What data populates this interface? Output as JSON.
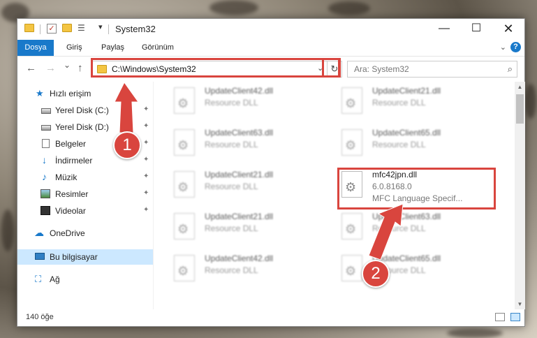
{
  "window": {
    "title": "System32",
    "minimize_glyph": "—",
    "maximize_glyph": "☐",
    "close_glyph": "✕",
    "qa_dropdown_glyph": "▾"
  },
  "ribbon": {
    "tabs": [
      "Dosya",
      "Giriş",
      "Paylaş",
      "Görünüm"
    ],
    "expand_glyph": "⌄",
    "help_glyph": "?"
  },
  "navigation": {
    "back_glyph": "←",
    "forward_glyph": "→",
    "recent_glyph": "⌄",
    "up_glyph": "↑",
    "address": "C:\\Windows\\System32",
    "address_dropdown_glyph": "⌄",
    "refresh_glyph": "↻",
    "search_placeholder": "Ara: System32",
    "search_glyph": "⌕"
  },
  "sidebar": {
    "items": [
      {
        "label": "Hızlı erişim",
        "icon": "star-icon",
        "glyph": "★"
      },
      {
        "label": "Yerel Disk (C:)",
        "icon": "disk-icon",
        "glyph": ""
      },
      {
        "label": "Yerel Disk (D:)",
        "icon": "disk-icon",
        "glyph": ""
      },
      {
        "label": "Belgeler",
        "icon": "documents-icon",
        "glyph": ""
      },
      {
        "label": "İndirmeler",
        "icon": "download-icon",
        "glyph": "↓"
      },
      {
        "label": "Müzik",
        "icon": "music-icon",
        "glyph": "♪"
      },
      {
        "label": "Resimler",
        "icon": "pictures-icon",
        "glyph": ""
      },
      {
        "label": "Videolar",
        "icon": "video-icon",
        "glyph": ""
      },
      {
        "label": "OneDrive",
        "icon": "cloud-icon",
        "glyph": "☁"
      },
      {
        "label": "Bu bilgisayar",
        "icon": "computer-icon",
        "glyph": ""
      },
      {
        "label": "Ağ",
        "icon": "network-icon",
        "glyph": "⛶"
      }
    ],
    "pin_glyph": "📌"
  },
  "files": [
    {
      "name": "UpdateClient42.dll",
      "type": "Resource DLL"
    },
    {
      "name": "UpdateClient21.dll",
      "type": "Resource DLL"
    },
    {
      "name": "UpdateClient63.dll",
      "type": "Resource DLL"
    },
    {
      "name": "UpdateClient65.dll",
      "type": "Resource DLL"
    },
    {
      "name": "UpdateClient21.dll",
      "type": "Resource DLL"
    },
    {
      "name": "mfc42jpn.dll",
      "version": "6.0.8168.0",
      "type": "MFC Language Specif..."
    },
    {
      "name": "UpdateClient21.dll",
      "type": "Resource DLL"
    },
    {
      "name": "UpdateClient63.dll",
      "type": "Resource DLL"
    },
    {
      "name": "UpdateClient42.dll",
      "type": "Resource DLL"
    },
    {
      "name": "UpdateClient65.dll",
      "type": "Resource DLL"
    }
  ],
  "scrollbar": {
    "up_glyph": "▲",
    "down_glyph": "▼"
  },
  "status": {
    "item_count": "140 öğe"
  },
  "callouts": {
    "step1": "1",
    "step2": "2",
    "color": "#d9453e"
  }
}
